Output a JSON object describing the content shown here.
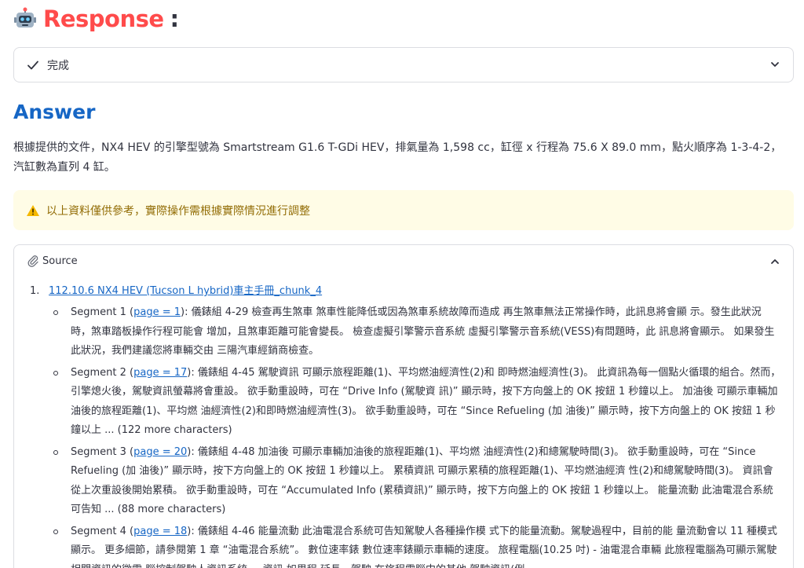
{
  "header": {
    "title": "Response",
    "colon": ":",
    "icon": "robot-icon"
  },
  "status": {
    "label": "完成",
    "icon": "check-icon",
    "toggle_icon": "chevron-down-icon"
  },
  "answer": {
    "title": "Answer",
    "text": "根據提供的文件，NX4 HEV 的引擎型號為 Smartstream G1.6 T-GDi HEV，排氣量為 1,598 cc，缸徑 x 行程為 75.6 X 89.0 mm，點火順序為 1-3-4-2，汽缸數為直列 4 缸。"
  },
  "warning": {
    "text": "以上資料僅供參考，實際操作需根據實際情況進行調整",
    "icon": "warning-icon"
  },
  "source": {
    "label": "Source",
    "icon": "paperclip-icon",
    "toggle_icon": "chevron-up-icon",
    "documents": [
      {
        "number": "1.",
        "link": "112.10.6 NX4 HEV (Tucson L hybrid)車主手冊_chunk_4",
        "segments": [
          {
            "prefix": "Segment 1 (",
            "page": "page = 1",
            "body": "): 儀錶組 4-29 檢查再生煞車 煞車性能降低或因為煞車系統故障而造成 再生煞車無法正常操作時，此訊息將會顯 示。發生此狀況時，煞車踏板操作行程可能會 增加，且煞車距離可能會變長。 檢查虛擬引擎警示音系統 虛擬引擎警示音系統(VESS)有問題時，此 訊息將會顯示。 如果發生此狀況，我們建議您將車輛交由 三陽汽車經銷商檢查。"
          },
          {
            "prefix": "Segment 2 (",
            "page": "page = 17",
            "body": "): 儀錶組 4-45 駕駛資訊 可顯示旅程距離(1)、平均燃油經濟性(2)和 即時燃油經濟性(3)。 此資訊為每一個點火循環的組合。然而， 引擎熄火後，駕駛資訊螢幕將會重設。 欲手動重設時，可在 “Drive Info (駕駛資 訊)” 顯示時，按下方向盤上的 OK 按鈕 1 秒鐘以上。 加油後 可顯示車輛加油後的旅程距離(1)、平均燃 油經濟性(2)和即時燃油經濟性(3)。 欲手動重設時，可在 “Since Refueling (加 油後)” 顯示時，按下方向盤上的 OK 按鈕 1 秒鐘以上 ... (122 more characters)"
          },
          {
            "prefix": "Segment 3 (",
            "page": "page = 20",
            "body": "): 儀錶組 4-48 加油後 可顯示車輛加油後的旅程距離(1)、平均燃 油經濟性(2)和總駕駛時間(3)。 欲手動重設時，可在 “Since Refueling (加 油後)” 顯示時，按下方向盤上的 OK 按鈕 1 秒鐘以上。 累積資訊 可顯示累積的旅程距離(1)、平均燃油經濟 性(2)和總駕駛時間(3)。 資訊會從上次重設後開始累積。 欲手動重設時，可在 “Accumulated Info (累積資訊)” 顯示時，按下方向盤上的 OK 按鈕 1 秒鐘以上。 能量流動 此油電混合系統可告知 ... (88 more characters)"
          },
          {
            "prefix": "Segment 4 (",
            "page": "page = 18",
            "body": "): 儀錶組 4-46 能量流動 此油電混合系統可告知駕駛人各種操作模 式下的能量流動。駕駛過程中，目前的能 量流動會以 11 種模式顯示。 更多細節，請參閱第 1 章 “油電混合系統”。 數位速率錶 數位速率錶顯示車輛的速度。 旅程電腦(10.25 吋) - 油電混合車輛 此旅程電腦為可顯示駕駛相關資訊的微電 腦控制駕駛人資訊系統，，資訊 如里程 延長、駕駛 在旅程電腦中的其他 駕駛資訊(例"
          }
        ]
      }
    ]
  }
}
